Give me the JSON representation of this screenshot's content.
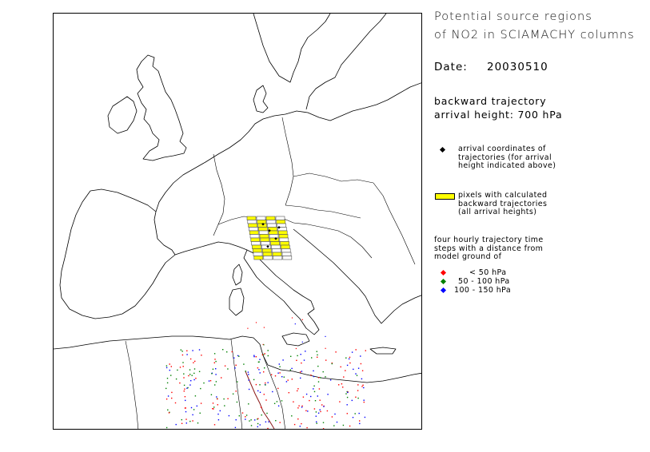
{
  "title": {
    "line1": "Potential source regions",
    "line2": "of NO2 in SCIAMACHY columns"
  },
  "date": {
    "label": "Date:",
    "value": "20030510"
  },
  "trajectory": {
    "line1": "backward trajectory",
    "line2": "arrival height: 700 hPa"
  },
  "legend": {
    "arrival": {
      "text": "arrival coordinates of\ntrajectories (for arrival\nheight indicated above)",
      "color": "#000000",
      "icon": "black-diamond-icon"
    },
    "pixels": {
      "text": "pixels with calculated\nbackward trajectories\n(all arrival heights)",
      "color": "#ffff00",
      "icon": "yellow-rectangle-icon"
    },
    "timesteps_text": "four hourly trajectory time\nsteps with a distance from\nmodel ground of",
    "ranges": [
      {
        "label": "< 50 hPa",
        "color": "#ff0000",
        "icon": "red-diamond-icon"
      },
      {
        "label": "50 - 100 hPa",
        "color": "#008000",
        "icon": "green-diamond-icon"
      },
      {
        "label": "100 - 150 hPa",
        "color": "#0000ff",
        "icon": "blue-diamond-icon"
      }
    ]
  },
  "colors": {
    "coastline": "#000000",
    "trajectory_path": "#8b1a1a",
    "pixel_fill": "#ffff00",
    "pixel_grid": "#555555"
  }
}
